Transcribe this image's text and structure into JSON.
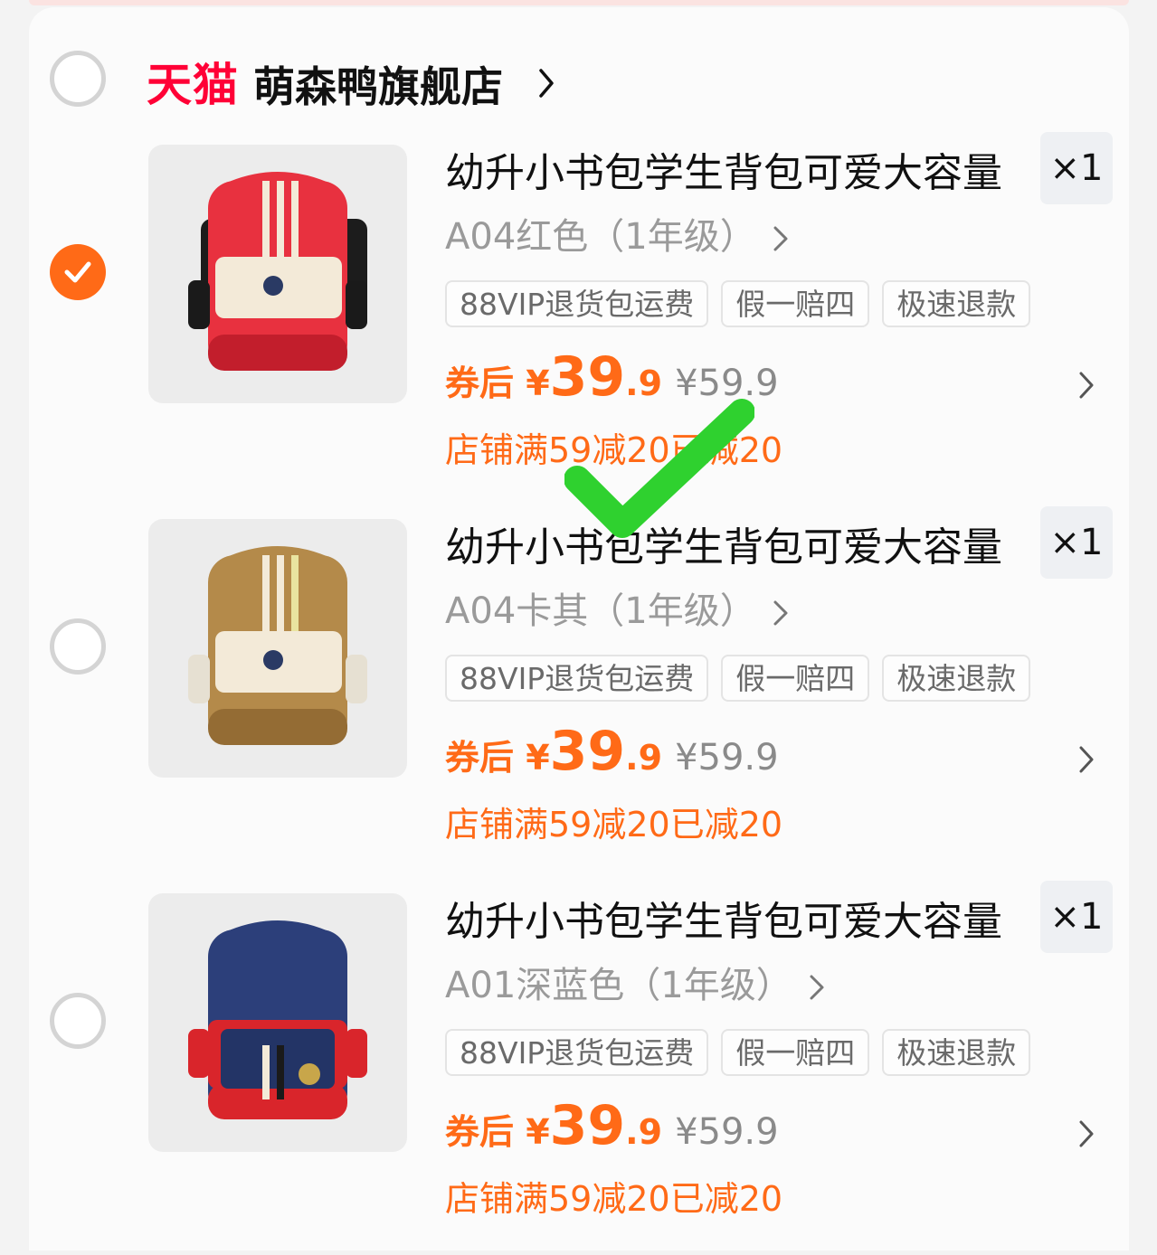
{
  "store": {
    "platform": "天猫",
    "name": "萌森鸭旗舰店",
    "selected": false
  },
  "items": [
    {
      "selected": true,
      "title": "幼升小书包学生背包可爱大容量",
      "quantity": "×1",
      "sku": "A04红色（1年级）",
      "tags": [
        "88VIP退货包运费",
        "假一赔四",
        "极速退款"
      ],
      "price_prefix": "券后 ¥",
      "price_int": "39",
      "price_dec": ".9",
      "original_price": "¥59.9",
      "promo": "店铺满59减20已减20",
      "bag_color": "#e8313f",
      "bag_shade": "#c21e2c"
    },
    {
      "selected": false,
      "title": "幼升小书包学生背包可爱大容量",
      "quantity": "×1",
      "sku": "A04卡其（1年级）",
      "tags": [
        "88VIP退货包运费",
        "假一赔四",
        "极速退款"
      ],
      "price_prefix": "券后 ¥",
      "price_int": "39",
      "price_dec": ".9",
      "original_price": "¥59.9",
      "promo": "店铺满59减20已减20",
      "bag_color": "#b48a4a",
      "bag_shade": "#946c34"
    },
    {
      "selected": false,
      "title": "幼升小书包学生背包可爱大容量",
      "quantity": "×1",
      "sku": "A01深蓝色（1年级）",
      "tags": [
        "88VIP退货包运费",
        "假一赔四",
        "极速退款"
      ],
      "price_prefix": "券后 ¥",
      "price_int": "39",
      "price_dec": ".9",
      "original_price": "¥59.9",
      "promo": "店铺满59减20已减20",
      "bag_color": "#2c3f7a",
      "bag_shade": "#1f2d5c"
    }
  ],
  "colors": {
    "accent": "#ff6a17",
    "tmall_red": "#ff0036",
    "overlay_check": "#2fd12f"
  },
  "icons": {
    "checkmark": "green-checkmark-overlay-icon",
    "chevron": "chevron-right-icon"
  }
}
